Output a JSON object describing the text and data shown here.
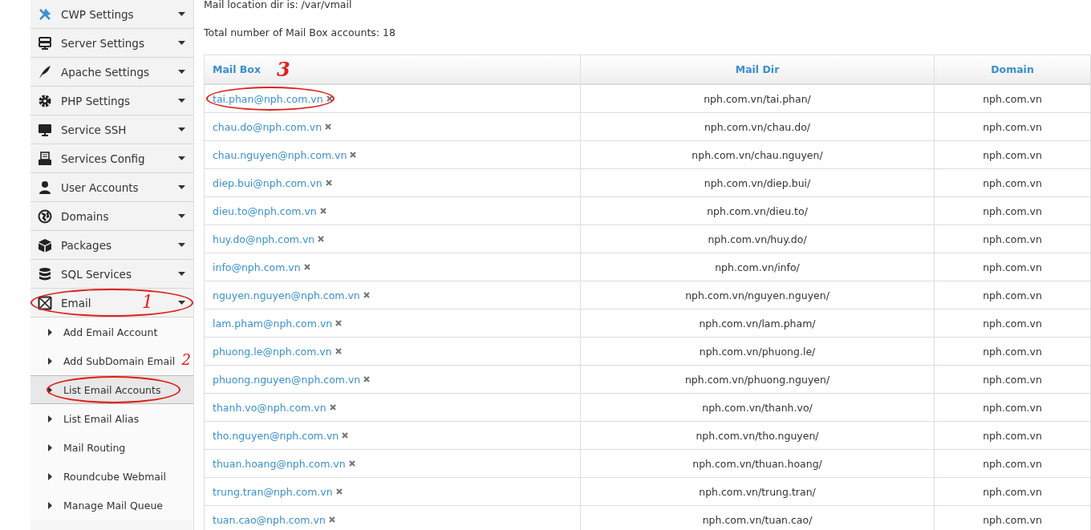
{
  "sidebar": {
    "items": [
      {
        "label": "CWP Settings"
      },
      {
        "label": "Server Settings"
      },
      {
        "label": "Apache Settings"
      },
      {
        "label": "PHP Settings"
      },
      {
        "label": "Service SSH"
      },
      {
        "label": "Services Config"
      },
      {
        "label": "User Accounts"
      },
      {
        "label": "Domains"
      },
      {
        "label": "Packages"
      },
      {
        "label": "SQL Services"
      },
      {
        "label": "Email",
        "circled": true,
        "note": "1",
        "children": [
          {
            "label": "Add Email Account",
            "selected": false
          },
          {
            "label": "Add SubDomain Email",
            "selected": false,
            "note": "2"
          },
          {
            "label": "List Email Accounts",
            "selected": true,
            "circled": true
          },
          {
            "label": "List Email Alias",
            "selected": false
          },
          {
            "label": "Mail Routing",
            "selected": false
          },
          {
            "label": "Roundcube Webmail",
            "selected": false
          },
          {
            "label": "Manage Mail Queue",
            "selected": false
          }
        ]
      }
    ]
  },
  "info": [
    "Mail location dir is: /var/vmail",
    "Total number of Mail Box accounts: 18"
  ],
  "table": {
    "columns": [
      {
        "label": "Mail Box",
        "note": "3"
      },
      {
        "label": "Mail Dir"
      },
      {
        "label": "Domain"
      }
    ],
    "rows": [
      {
        "mailbox": "tai.phan@nph.com.vn",
        "dir": "nph.com.vn/tai.phan/",
        "domain": "nph.com.vn",
        "circled": true
      },
      {
        "mailbox": "chau.do@nph.com.vn",
        "dir": "nph.com.vn/chau.do/",
        "domain": "nph.com.vn"
      },
      {
        "mailbox": "chau.nguyen@nph.com.vn",
        "dir": "nph.com.vn/chau.nguyen/",
        "domain": "nph.com.vn"
      },
      {
        "mailbox": "diep.bui@nph.com.vn",
        "dir": "nph.com.vn/diep.bui/",
        "domain": "nph.com.vn"
      },
      {
        "mailbox": "dieu.to@nph.com.vn",
        "dir": "nph.com.vn/dieu.to/",
        "domain": "nph.com.vn"
      },
      {
        "mailbox": "huy.do@nph.com.vn",
        "dir": "nph.com.vn/huy.do/",
        "domain": "nph.com.vn"
      },
      {
        "mailbox": "info@nph.com.vn",
        "dir": "nph.com.vn/info/",
        "domain": "nph.com.vn"
      },
      {
        "mailbox": "nguyen.nguyen@nph.com.vn",
        "dir": "nph.com.vn/nguyen.nguyen/",
        "domain": "nph.com.vn"
      },
      {
        "mailbox": "lam.pham@nph.com.vn",
        "dir": "nph.com.vn/lam.pham/",
        "domain": "nph.com.vn"
      },
      {
        "mailbox": "phuong.le@nph.com.vn",
        "dir": "nph.com.vn/phuong.le/",
        "domain": "nph.com.vn"
      },
      {
        "mailbox": "phuong.nguyen@nph.com.vn",
        "dir": "nph.com.vn/phuong.nguyen/",
        "domain": "nph.com.vn"
      },
      {
        "mailbox": "thanh.vo@nph.com.vn",
        "dir": "nph.com.vn/thanh.vo/",
        "domain": "nph.com.vn"
      },
      {
        "mailbox": "tho.nguyen@nph.com.vn",
        "dir": "nph.com.vn/tho.nguyen/",
        "domain": "nph.com.vn"
      },
      {
        "mailbox": "thuan.hoang@nph.com.vn",
        "dir": "nph.com.vn/thuan.hoang/",
        "domain": "nph.com.vn"
      },
      {
        "mailbox": "trung.tran@nph.com.vn",
        "dir": "nph.com.vn/trung.tran/",
        "domain": "nph.com.vn"
      },
      {
        "mailbox": "tuan.cao@nph.com.vn",
        "dir": "nph.com.vn/tuan.cao/",
        "domain": "nph.com.vn"
      }
    ]
  }
}
